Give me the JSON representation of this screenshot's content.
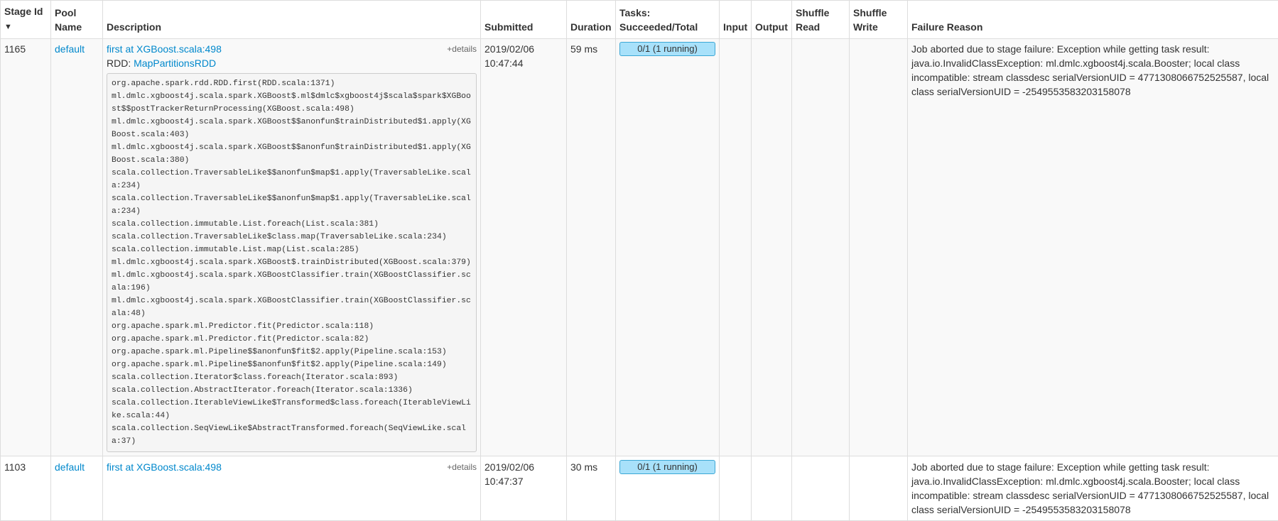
{
  "headers": {
    "stage_id": "Stage Id",
    "stage_id_sort": "▼",
    "pool_name": "Pool Name",
    "description": "Description",
    "submitted": "Submitted",
    "duration": "Duration",
    "tasks": "Tasks: Succeeded/Total",
    "input": "Input",
    "output": "Output",
    "shuffle_read": "Shuffle Read",
    "shuffle_write": "Shuffle Write",
    "failure_reason": "Failure Reason"
  },
  "rows": [
    {
      "stage_id": "1165",
      "pool": "default",
      "description": "first at XGBoost.scala:498",
      "details_toggle": "+details",
      "rdd_label": "RDD:",
      "rdd_name": "MapPartitionsRDD",
      "stack": "org.apache.spark.rdd.RDD.first(RDD.scala:1371)\nml.dmlc.xgboost4j.scala.spark.XGBoost$.ml$dmlc$xgboost4j$scala$spark$XGBoost$$postTrackerReturnProcessing(XGBoost.scala:498)\nml.dmlc.xgboost4j.scala.spark.XGBoost$$anonfun$trainDistributed$1.apply(XGBoost.scala:403)\nml.dmlc.xgboost4j.scala.spark.XGBoost$$anonfun$trainDistributed$1.apply(XGBoost.scala:380)\nscala.collection.TraversableLike$$anonfun$map$1.apply(TraversableLike.scala:234)\nscala.collection.TraversableLike$$anonfun$map$1.apply(TraversableLike.scala:234)\nscala.collection.immutable.List.foreach(List.scala:381)\nscala.collection.TraversableLike$class.map(TraversableLike.scala:234)\nscala.collection.immutable.List.map(List.scala:285)\nml.dmlc.xgboost4j.scala.spark.XGBoost$.trainDistributed(XGBoost.scala:379)\nml.dmlc.xgboost4j.scala.spark.XGBoostClassifier.train(XGBoostClassifier.scala:196)\nml.dmlc.xgboost4j.scala.spark.XGBoostClassifier.train(XGBoostClassifier.scala:48)\norg.apache.spark.ml.Predictor.fit(Predictor.scala:118)\norg.apache.spark.ml.Predictor.fit(Predictor.scala:82)\norg.apache.spark.ml.Pipeline$$anonfun$fit$2.apply(Pipeline.scala:153)\norg.apache.spark.ml.Pipeline$$anonfun$fit$2.apply(Pipeline.scala:149)\nscala.collection.Iterator$class.foreach(Iterator.scala:893)\nscala.collection.AbstractIterator.foreach(Iterator.scala:1336)\nscala.collection.IterableViewLike$Transformed$class.foreach(IterableViewLike.scala:44)\nscala.collection.SeqViewLike$AbstractTransformed.foreach(SeqViewLike.scala:37)",
      "submitted": "2019/02/06 10:47:44",
      "duration": "59 ms",
      "tasks": "0/1 (1 running)",
      "tasks_succeeded_fraction": 0,
      "input": "",
      "output": "",
      "shuffle_read": "",
      "shuffle_write": "",
      "failure_reason": "Job aborted due to stage failure: Exception while getting task result: java.io.InvalidClassException: ml.dmlc.xgboost4j.scala.Booster; local class incompatible: stream classdesc serialVersionUID = 4771308066752525587, local class serialVersionUID = -2549553583203158078"
    },
    {
      "stage_id": "1103",
      "pool": "default",
      "description": "first at XGBoost.scala:498",
      "details_toggle": "+details",
      "submitted": "2019/02/06 10:47:37",
      "duration": "30 ms",
      "tasks": "0/1 (1 running)",
      "tasks_succeeded_fraction": 0,
      "input": "",
      "output": "",
      "shuffle_read": "",
      "shuffle_write": "",
      "failure_reason": "Job aborted due to stage failure: Exception while getting task result: java.io.InvalidClassException: ml.dmlc.xgboost4j.scala.Booster; local class incompatible: stream classdesc serialVersionUID = 4771308066752525587, local class serialVersionUID = -2549553583203158078"
    }
  ]
}
